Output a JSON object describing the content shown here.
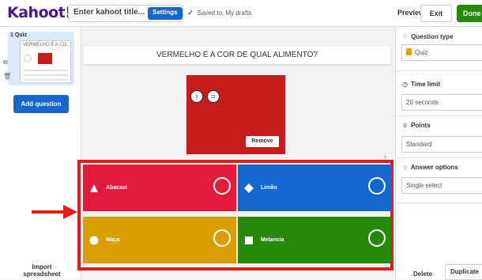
{
  "header": {
    "logo": "Kahoot!",
    "title_placeholder": "Enter kahoot title...",
    "settings_label": "Settings",
    "saved_text": "Saved to: My drafts",
    "preview_label": "Preview",
    "exit_label": "Exit",
    "done_label": "Done"
  },
  "sidebar": {
    "slide_label": "1 Quiz",
    "thumb_title": "VERMELHO É A CO...",
    "add_question_label": "Add question",
    "import_label": "Import spreadsheet"
  },
  "question": {
    "text": "VERMELHO É A COR DE QUAL ALIMENTO?",
    "remove_label": "Remove"
  },
  "answers": [
    {
      "label": "Abacaxi",
      "color": "#e21b3c",
      "shape": "triangle"
    },
    {
      "label": "Limão",
      "color": "#1368ce",
      "shape": "diamond"
    },
    {
      "label": "Maça",
      "color": "#d89e00",
      "shape": "circle"
    },
    {
      "label": "Melancia",
      "color": "#26890c",
      "shape": "square"
    }
  ],
  "right_panel": {
    "question_type_label": "Question type",
    "question_type_value": "Quiz",
    "time_limit_label": "Time limit",
    "time_limit_value": "20 seconds",
    "points_label": "Points",
    "points_value": "Standard",
    "answer_options_label": "Answer options",
    "answer_options_value": "Single select",
    "delete_label": "Delete",
    "duplicate_label": "Duplicate"
  }
}
